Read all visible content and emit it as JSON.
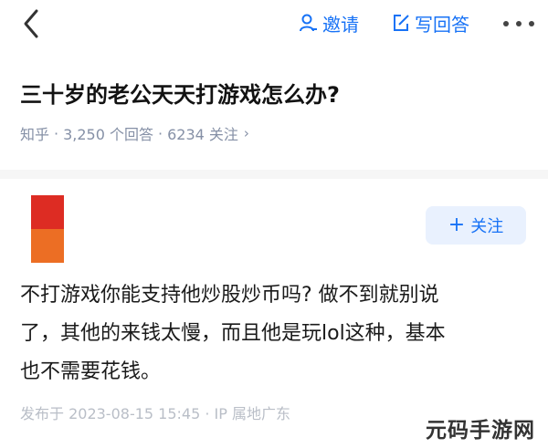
{
  "header": {
    "invite_label": "邀请",
    "write_answer_label": "写回答"
  },
  "question": {
    "title": "三十岁的老公天天打游戏怎么办?",
    "source": "知乎",
    "answers_count": "3,250 个回答",
    "followers_count": "6234 关注",
    "separator": "·"
  },
  "answer": {
    "follow_label": "关注",
    "lines": [
      "不打游戏你能支持他炒股炒币吗? 做不到就别说",
      "了，其他的来钱太慢，而且他是玩lol这种，基本",
      "也不需要花钱。"
    ],
    "posted_info": "发布于 2023-08-15 15:45 · IP 属地广东"
  },
  "watermark": "元码手游网",
  "colors": {
    "accent": "#1772f6",
    "muted": "#8590a6",
    "avatar_top": "#dd2c23",
    "avatar_bottom": "#ec6e24"
  },
  "icons": [
    "chevron-left-icon",
    "person-icon",
    "edit-icon",
    "more-icon",
    "chevron-right-icon"
  ]
}
